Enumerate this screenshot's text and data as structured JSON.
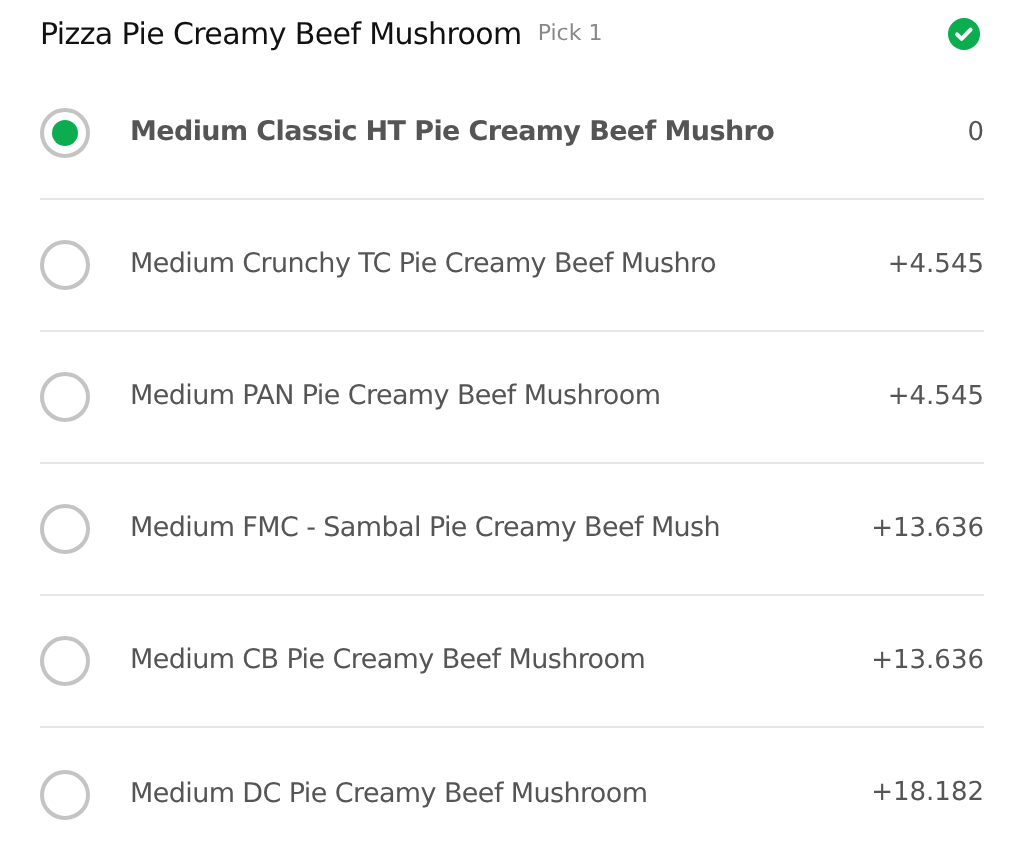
{
  "group": {
    "title": "Pizza Pie Creamy Beef Mushroom",
    "hint": "Pick 1",
    "complete": true
  },
  "options": [
    {
      "name": "Medium Classic HT Pie Creamy Beef Mushro",
      "price": "0",
      "selected": true
    },
    {
      "name": "Medium Crunchy TC Pie Creamy Beef Mushro",
      "price": "+4.545",
      "selected": false
    },
    {
      "name": "Medium PAN Pie Creamy Beef Mushroom",
      "price": "+4.545",
      "selected": false
    },
    {
      "name": "Medium FMC - Sambal Pie Creamy Beef Mush",
      "price": "+13.636",
      "selected": false
    },
    {
      "name": "Medium CB Pie Creamy Beef Mushroom",
      "price": "+13.636",
      "selected": false
    },
    {
      "name": "Medium DC Pie Creamy Beef Mushroom",
      "price": "+18.182",
      "selected": false
    }
  ]
}
